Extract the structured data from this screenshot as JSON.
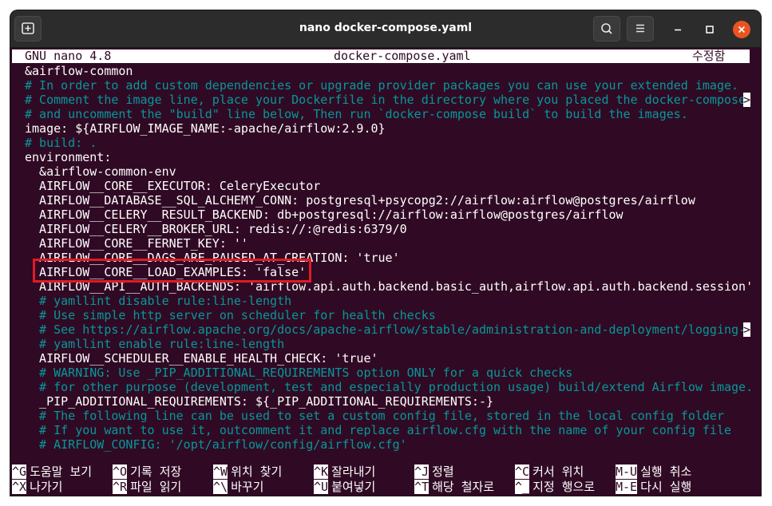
{
  "window": {
    "title": "nano docker-compose.yaml"
  },
  "nano_header": {
    "version": "GNU nano 4.8",
    "filename": "docker-compose.yaml",
    "status": "수정함"
  },
  "editor_lines": [
    {
      "text": "&airflow-common",
      "type": "text"
    },
    {
      "text": "# In order to add custom dependencies or upgrade provider packages you can use your extended image.",
      "type": "comment"
    },
    {
      "text": "# Comment the image line, place your Dockerfile in the directory where you placed the docker-compose",
      "type": "comment",
      "trunc": ">"
    },
    {
      "text": "# and uncomment the \"build\" line below, Then run `docker-compose build` to build the images.",
      "type": "comment"
    },
    {
      "text": "image: ${AIRFLOW_IMAGE_NAME:-apache/airflow:2.9.0}",
      "type": "text"
    },
    {
      "text": "# build: .",
      "type": "comment"
    },
    {
      "text": "environment:",
      "type": "text"
    },
    {
      "text": "  &airflow-common-env",
      "type": "text"
    },
    {
      "text": "  AIRFLOW__CORE__EXECUTOR: CeleryExecutor",
      "type": "text"
    },
    {
      "text": "  AIRFLOW__DATABASE__SQL_ALCHEMY_CONN: postgresql+psycopg2://airflow:airflow@postgres/airflow",
      "type": "text"
    },
    {
      "text": "  AIRFLOW__CELERY__RESULT_BACKEND: db+postgresql://airflow:airflow@postgres/airflow",
      "type": "text"
    },
    {
      "text": "  AIRFLOW__CELERY__BROKER_URL: redis://:@redis:6379/0",
      "type": "text"
    },
    {
      "text": "  AIRFLOW__CORE__FERNET_KEY: ''",
      "type": "text"
    },
    {
      "text": "  AIRFLOW__CORE__DAGS_ARE_PAUSED_AT_CREATION: 'true'",
      "type": "text"
    },
    {
      "text": "  AIRFLOW__CORE__LOAD_EXAMPLES: 'false'",
      "type": "text"
    },
    {
      "text": "  AIRFLOW__API__AUTH_BACKENDS: 'airflow.api.auth.backend.basic_auth,airflow.api.auth.backend.session'",
      "type": "text"
    },
    {
      "text": "  # yamllint disable rule:line-length",
      "type": "comment"
    },
    {
      "text": "  # Use simple http server on scheduler for health checks",
      "type": "comment"
    },
    {
      "text": "  # See https://airflow.apache.org/docs/apache-airflow/stable/administration-and-deployment/logging-",
      "type": "comment",
      "trunc": ">"
    },
    {
      "text": "  # yamllint enable rule:line-length",
      "type": "comment"
    },
    {
      "text": "  AIRFLOW__SCHEDULER__ENABLE_HEALTH_CHECK: 'true'",
      "type": "text"
    },
    {
      "text": "  # WARNING: Use _PIP_ADDITIONAL_REQUIREMENTS option ONLY for a quick checks",
      "type": "comment"
    },
    {
      "text": "  # for other purpose (development, test and especially production usage) build/extend Airflow image.",
      "type": "comment"
    },
    {
      "text": "  _PIP_ADDITIONAL_REQUIREMENTS: ${_PIP_ADDITIONAL_REQUIREMENTS:-}",
      "type": "text"
    },
    {
      "text": "  # The following line can be used to set a custom config file, stored in the local config folder",
      "type": "comment"
    },
    {
      "text": "  # If you want to use it, outcomment it and replace airflow.cfg with the name of your config file",
      "type": "comment"
    },
    {
      "text": "  # AIRFLOW_CONFIG: '/opt/airflow/config/airflow.cfg'",
      "type": "comment"
    }
  ],
  "help_row1": [
    {
      "key": "^G",
      "label": "도움말 보기"
    },
    {
      "key": "^O",
      "label": "기록 저장"
    },
    {
      "key": "^W",
      "label": "위치 찾기"
    },
    {
      "key": "^K",
      "label": "잘라내기"
    },
    {
      "key": "^J",
      "label": "정렬"
    },
    {
      "key": "^C",
      "label": "커서 위치"
    },
    {
      "key": "M-U",
      "label": "실행 취소"
    }
  ],
  "help_row2": [
    {
      "key": "^X",
      "label": "나가기"
    },
    {
      "key": "^R",
      "label": "파일 읽기"
    },
    {
      "key": "^\\",
      "label": "바꾸기"
    },
    {
      "key": "^U",
      "label": "붙여넣기"
    },
    {
      "key": "^T",
      "label": "해당 철자로"
    },
    {
      "key": "^_",
      "label": "지정 행으로"
    },
    {
      "key": "M-E",
      "label": "다시 실행"
    }
  ],
  "colors": {
    "terminal_bg": "#300a24",
    "comment": "#06989a",
    "text": "#ffffff",
    "highlight_box": "#e01b24"
  },
  "icons": {
    "new_tab": "new-tab-icon",
    "search": "search-icon",
    "menu": "hamburger-menu-icon",
    "minimize": "minimize-icon",
    "maximize": "maximize-icon",
    "close": "close-icon"
  }
}
